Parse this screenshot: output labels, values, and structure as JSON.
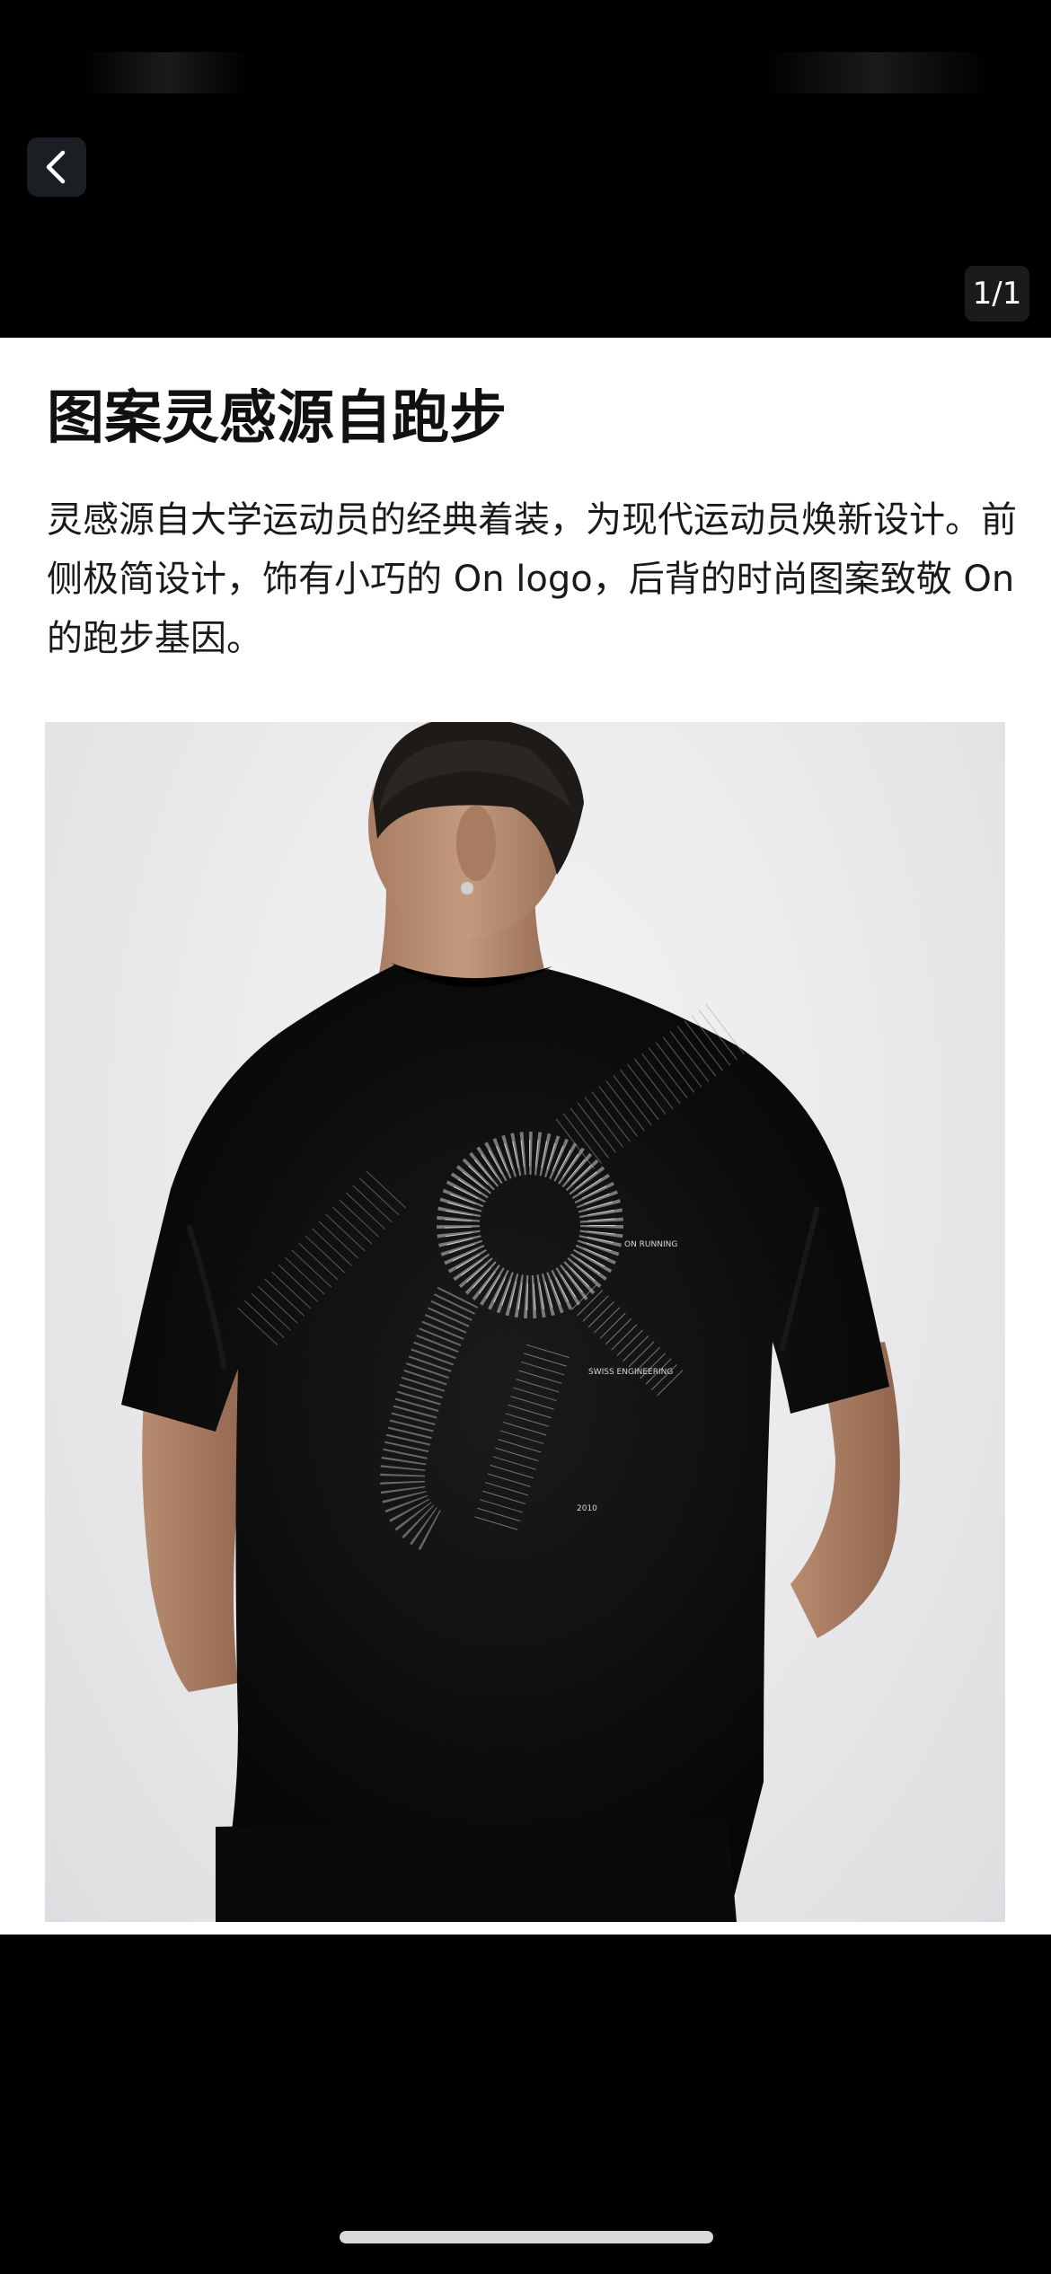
{
  "viewer": {
    "page_counter": "1/1",
    "back_icon": "chevron-left-icon"
  },
  "article": {
    "headline": "图案灵感源自跑步",
    "description": "灵感源自大学运动员的经典着装，为现代运动员焕新设计。前侧极简设计，饰有小巧的 On logo，后背的时尚图案致敬 On 的跑步基因。"
  },
  "photo": {
    "print_lines": [
      "ON RUNNING",
      "SWISS ENGINEERING",
      "2010"
    ]
  },
  "colors": {
    "background": "#000000",
    "card": "#ffffff",
    "shirt": "#0b0b0b",
    "headline_text": "#111111"
  }
}
